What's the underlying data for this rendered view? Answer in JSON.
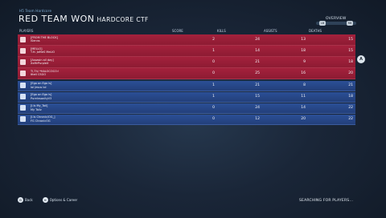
{
  "breadcrumb": "H5 Team Hardcore",
  "result": {
    "title": "RED TEAM WON",
    "mode": "HARDCORE CTF"
  },
  "overview": {
    "label": "OVERVIEW",
    "lb": "LB",
    "rb": "RB"
  },
  "columns": {
    "players": "PLAYERS",
    "score": "SCORE",
    "kills": "KILLS",
    "assists": "ASSISTS",
    "deaths": "DEATHS"
  },
  "red_team": [
    {
      "line1": "[FROM THE BLOCK]",
      "line2": "iSenns",
      "score": "2",
      "kills": "24",
      "assists": "13",
      "deaths": "15"
    },
    {
      "line1": "[MELLO]",
      "line2": "T.H. JaMeS MeLlO",
      "score": "1",
      "kills": "14",
      "assists": "18",
      "deaths": "15"
    },
    {
      "line1": "[Assasin all day]",
      "line2": "XxMrPurpleX",
      "score": "0",
      "kills": "21",
      "assists": "9",
      "deaths": "18"
    },
    {
      "line1": "T\\.Th/ *HALOCOCO:!",
      "line2": "Ittell CSGO",
      "score": "0",
      "kills": "25",
      "assists": "16",
      "deaths": "20"
    }
  ],
  "blue_team": [
    {
      "line1": "[Ego on Ego is]",
      "line2": "lol Jesus lol",
      "score": "1",
      "kills": "21",
      "assists": "8",
      "deaths": "21"
    },
    {
      "line1": "[Ego on Ego is]",
      "line2": "PureInsanityV3",
      "score": "1",
      "kills": "15",
      "assists": "11",
      "deaths": "18"
    },
    {
      "line1": "[I.Is My_Tail]",
      "line2": "My Tailz",
      "score": "0",
      "kills": "24",
      "assists": "14",
      "deaths": "22"
    },
    {
      "line1": "[I.Is Chronic/OG_]",
      "line2": "FG ChronicOG",
      "score": "0",
      "kills": "12",
      "assists": "20",
      "deaths": "22"
    }
  ],
  "side_button": "A",
  "footer": {
    "back_key": "B",
    "back_label": "Back",
    "options_key": "≡",
    "options_label": "Options & Career",
    "status": "SEARCHING FOR PLAYERS..."
  },
  "colors": {
    "red_team": "#a4213c",
    "blue_team": "#2b4f96"
  }
}
